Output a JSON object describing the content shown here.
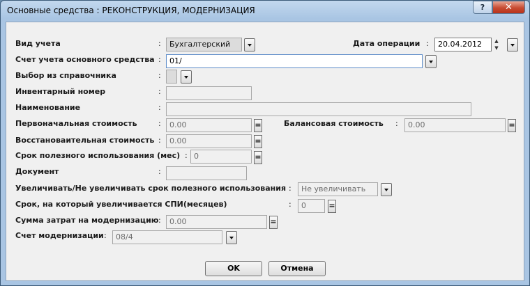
{
  "window": {
    "title": "Основные средства : РЕКОНСТРУКЦИЯ, МОДЕРНИЗАЦИЯ",
    "help_label": "?",
    "close_label": "✕"
  },
  "form": {
    "colon": ":",
    "eq": "=",
    "vid_ucheta": {
      "label": "Вид учета",
      "value": "Бухгалтерский"
    },
    "data_operacii": {
      "label": "Дата операции",
      "value": "20.04.2012"
    },
    "schet_ucheta": {
      "label": "Счет учета основного средства",
      "value": "01/"
    },
    "vybor": {
      "label": "Выбор из справочника",
      "value": ""
    },
    "inv_nomer": {
      "label": "Инвентарный номер",
      "value": ""
    },
    "naimenovanie": {
      "label": "Наименование",
      "value": ""
    },
    "perv_stoimost": {
      "label": "Первоначальная стоимость",
      "value": "0.00"
    },
    "bal_stoimost": {
      "label": "Балансовая стоимость",
      "value": "0.00"
    },
    "vosst_stoimost": {
      "label": "Восстановаительная стоимость",
      "value": "0.00"
    },
    "srok": {
      "label": "Срок полезного использования (мес)",
      "value": "0"
    },
    "dokument": {
      "label": "Документ",
      "value": ""
    },
    "uvelichivat": {
      "label": "Увеличивать/Не увеличивать срок полезного использования",
      "value": "Не увеличивать"
    },
    "srok_uvel": {
      "label": "Срок, на который увеличивается СПИ(месяцев)",
      "value": "0"
    },
    "summa_zatrat": {
      "label": "Сумма затрат на модернизацию",
      "value": "0.00"
    },
    "schet_modern": {
      "label": "Счет модернизации",
      "value": "08/4"
    }
  },
  "buttons": {
    "ok": "OK",
    "cancel": "Отмена"
  }
}
